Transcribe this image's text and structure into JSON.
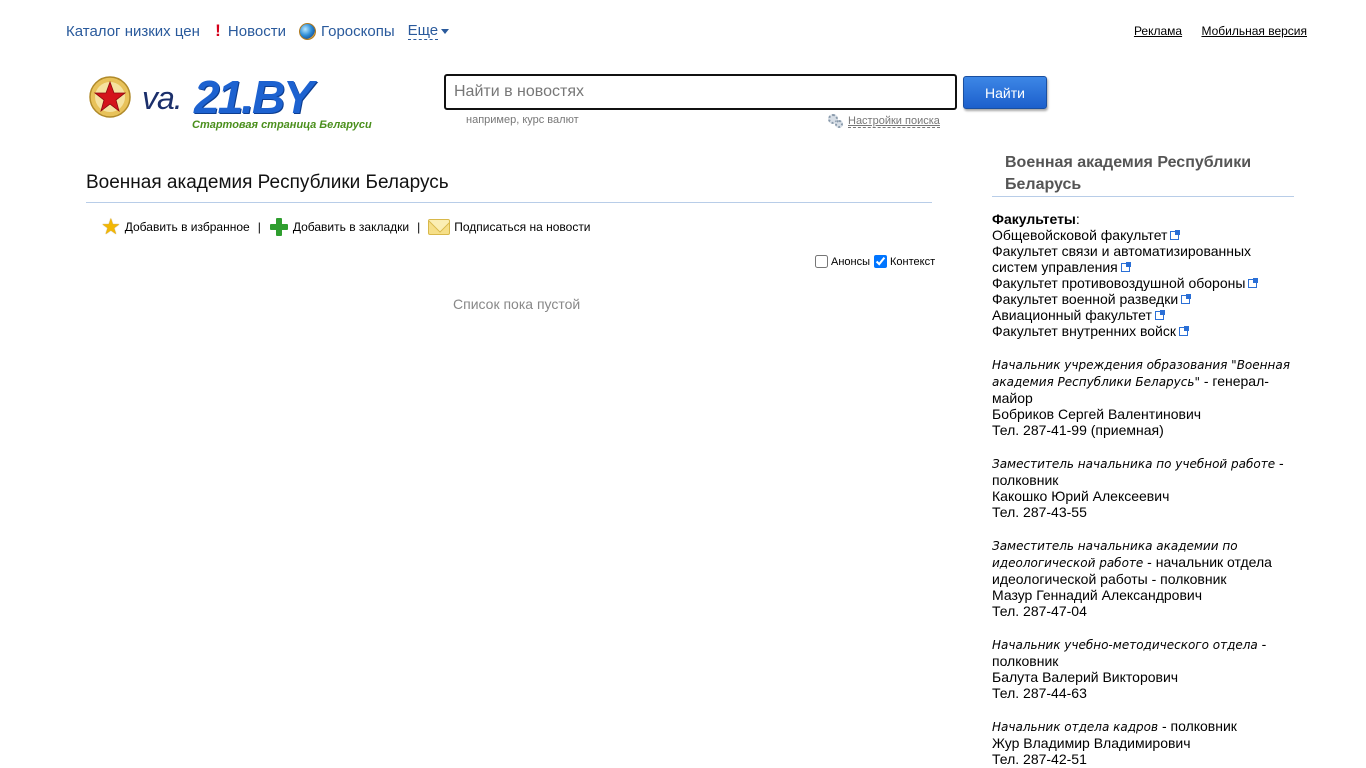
{
  "topnav": {
    "catalog": "Каталог низких цен",
    "news": "Новости",
    "horoscopes": "Гороскопы",
    "more": "Еще"
  },
  "toplinks": {
    "ads": "Реклама",
    "mobile": "Мобильная версия"
  },
  "logo": {
    "prefix": "va.",
    "brand": "21.BY",
    "tagline": "Стартовая страница Беларуси"
  },
  "search": {
    "placeholder": "Найти в новостях",
    "button": "Найти",
    "hint": "например, курс валют",
    "settings": "Настройки поиска"
  },
  "main": {
    "title": "Военная академия Республики Беларусь",
    "actions": {
      "favorites": "Добавить в избранное",
      "bookmarks": "Добавить в закладки",
      "subscribe": "Подписаться на новости",
      "separator": "|"
    },
    "filters": {
      "announcements": "Анонсы",
      "context": "Контекст"
    },
    "empty": "Список пока пустой"
  },
  "sidebar": {
    "title": "Военная академия Республики Беларусь",
    "faculties_label": "Факультеты",
    "faculties": [
      "Общевойсковой факультет",
      "Факультет связи и автоматизированных систем управления",
      "Факультет противовоздушной обороны",
      "Факультет военной разведки",
      "Авиационный факультет",
      "Факультет внутренних войск"
    ],
    "contacts": [
      {
        "position": "Начальник учреждения образования \"Военная академия Республики Беларусь\"",
        "rank": " - генерал-майор",
        "name": "Бобриков Сергей Валентинович",
        "phone": "Тел. 287-41-99 (приемная)"
      },
      {
        "position": "Заместитель начальника по учебной работе",
        "rank": " - полковник",
        "name": "Какошко Юрий Алексеевич",
        "phone": "Тел. 287-43-55"
      },
      {
        "position": "Заместитель начальника академии по идеологической работе",
        "rank": " - начальник отдела идеологической работы - полковник",
        "name": "Мазур Геннадий Александрович",
        "phone": "Тел. 287-47-04"
      },
      {
        "position": "Начальник учебно-методического отдела",
        "rank": " - полковник",
        "name": "Балута Валерий Викторович",
        "phone": "Тел. 287-44-63"
      },
      {
        "position": "Начальник отдела кадров",
        "rank": " - полковник",
        "name": "Жур Владимир Владимирович",
        "phone": "Тел. 287-42-51"
      }
    ]
  },
  "colors": {
    "link": "#2a5a9c",
    "brand_blue": "#1d62d0",
    "tagline_green": "#4a8f1c",
    "rule": "#b8cde8"
  }
}
